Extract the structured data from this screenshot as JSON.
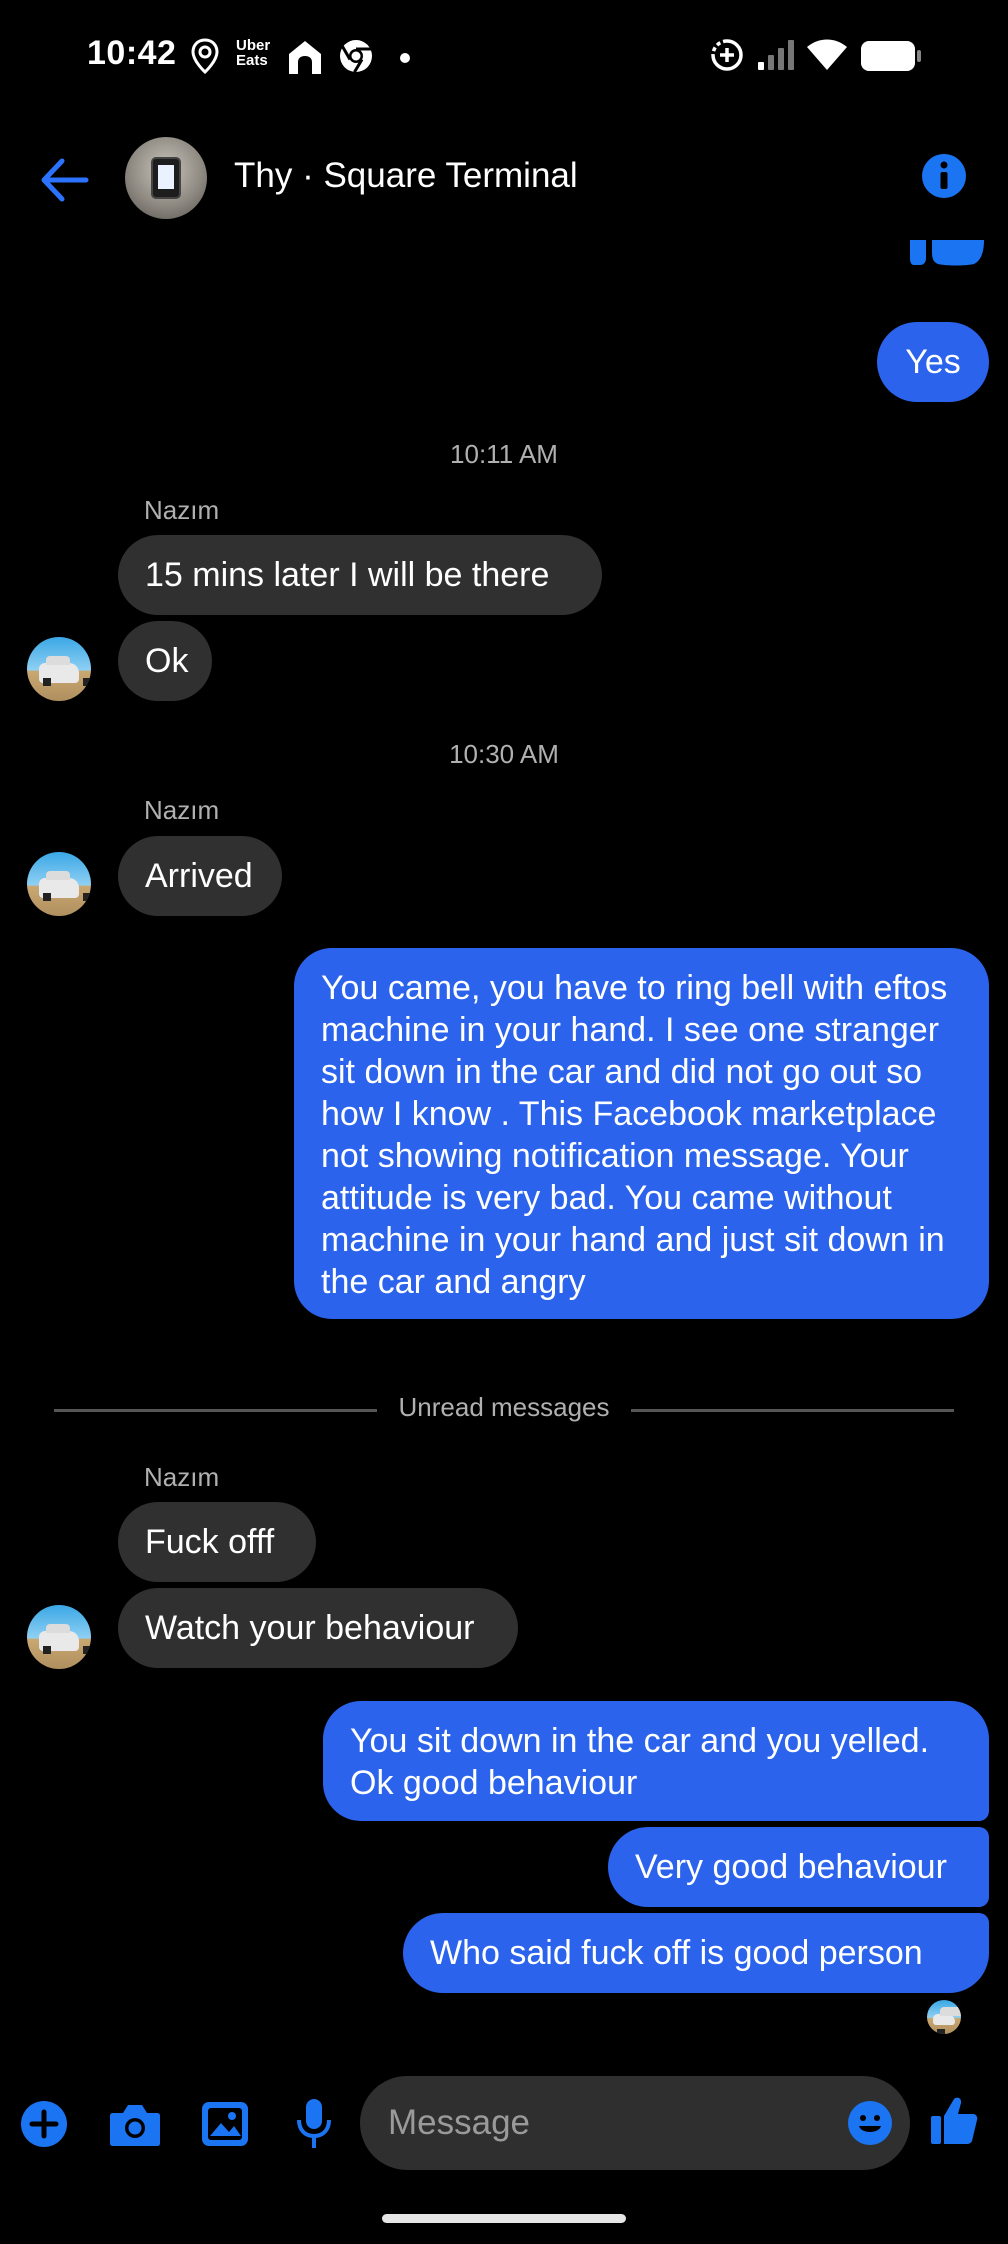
{
  "status_bar": {
    "time": "10:42",
    "uber_eats_line1": "Uber",
    "uber_eats_line2": "Eats"
  },
  "header": {
    "title": "Thy · Square Terminal"
  },
  "messages": [
    {
      "kind": "outgoing",
      "text": "Yes"
    },
    {
      "kind": "timestamp",
      "text": "10:11 AM"
    },
    {
      "kind": "sender",
      "text": "Nazım"
    },
    {
      "kind": "incoming",
      "text": "15 mins later I will be there"
    },
    {
      "kind": "incoming",
      "text": "Ok"
    },
    {
      "kind": "timestamp",
      "text": "10:30 AM"
    },
    {
      "kind": "sender",
      "text": "Nazım"
    },
    {
      "kind": "incoming",
      "text": "Arrived"
    },
    {
      "kind": "outgoing",
      "text": "You came, you have to ring bell with eftos machine in your hand. I see one stranger sit down in the car and did not go out so how I know . This Facebook marketplace not showing notification message. Your attitude is very bad. You came without machine in your hand and just sit down in the car and angry"
    },
    {
      "kind": "divider",
      "text": "Unread messages"
    },
    {
      "kind": "sender",
      "text": "Nazım"
    },
    {
      "kind": "incoming",
      "text": "Fuck offf"
    },
    {
      "kind": "incoming",
      "text": "Watch your behaviour"
    },
    {
      "kind": "outgoing",
      "text": "You sit down in the car and you yelled. Ok good behaviour"
    },
    {
      "kind": "outgoing",
      "text": "Very good behaviour"
    },
    {
      "kind": "outgoing",
      "text": "Who said fuck off is good person"
    }
  ],
  "composer": {
    "placeholder": "Message"
  },
  "colors": {
    "accent": "#2b63ed",
    "icon_blue": "#1b74f2",
    "incoming_bubble": "#303030",
    "background": "#000000"
  },
  "icons": [
    "location-pin-icon",
    "uber-eats-icon",
    "home-app-icon",
    "chrome-icon",
    "dot-icon",
    "data-saver-icon",
    "signal-icon",
    "wifi-icon",
    "battery-icon",
    "back-arrow-icon",
    "info-icon",
    "plus-icon",
    "camera-icon",
    "image-icon",
    "microphone-icon",
    "emoji-icon",
    "thumbs-up-icon"
  ]
}
